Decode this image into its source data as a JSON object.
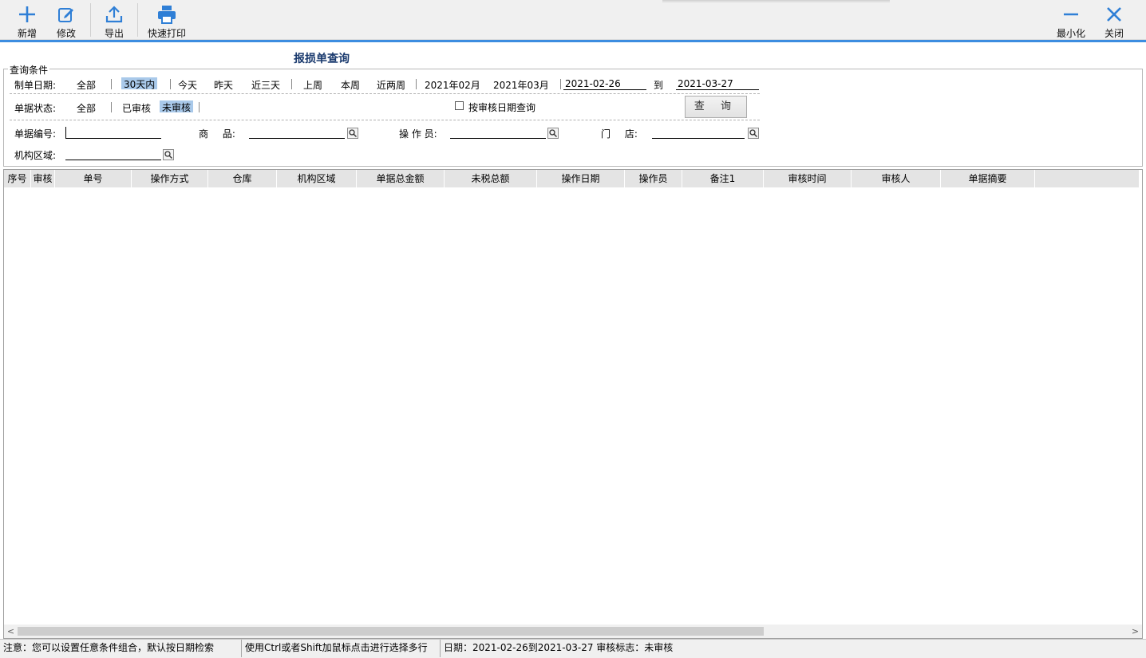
{
  "toolbar": {
    "add_label": "新增",
    "edit_label": "修改",
    "export_label": "导出",
    "print_label": "快速打印",
    "minimize_label": "最小化",
    "close_label": "关闭"
  },
  "accent_color": "#3c8de0",
  "form_title": "报损单查询",
  "query": {
    "legend": "查询条件",
    "date_label": "制单日期:",
    "date_options": [
      "全部",
      "30天内",
      "今天",
      "昨天",
      "近三天",
      "上周",
      "本周",
      "近两周",
      "2021年02月",
      "2021年03月"
    ],
    "date_selected": "30天内",
    "date_from": "2021-02-26",
    "date_to_label": "到",
    "date_to": "2021-03-27",
    "status_label": "单据状态:",
    "status_options": [
      "全部",
      "已审核",
      "未审核"
    ],
    "status_selected": "未审核",
    "audit_date_checkbox": "按审核日期查询",
    "query_button": "查 询",
    "doc_no_label": "单据编号:",
    "doc_no_value": "",
    "goods_label": "商 品:",
    "goods_value": "",
    "operator_label": "操 作 员:",
    "operator_value": "",
    "store_label": "门 店:",
    "store_value": "",
    "region_label": "机构区域:",
    "region_value": ""
  },
  "grid": {
    "columns": [
      "序号",
      "审核",
      "单号",
      "操作方式",
      "仓库",
      "机构区域",
      "单据总金额",
      "未税总额",
      "操作日期",
      "操作员",
      "备注1",
      "审核时间",
      "审核人",
      "单据摘要"
    ],
    "rows": []
  },
  "status_bar": {
    "hint": "注意：您可以设置任意条件组合，默认按日期检索",
    "multi_select": "使用Ctrl或者Shift加鼠标点击进行选择多行",
    "summary": "日期：2021-02-26到2021-03-27 审核标志：未审核"
  }
}
